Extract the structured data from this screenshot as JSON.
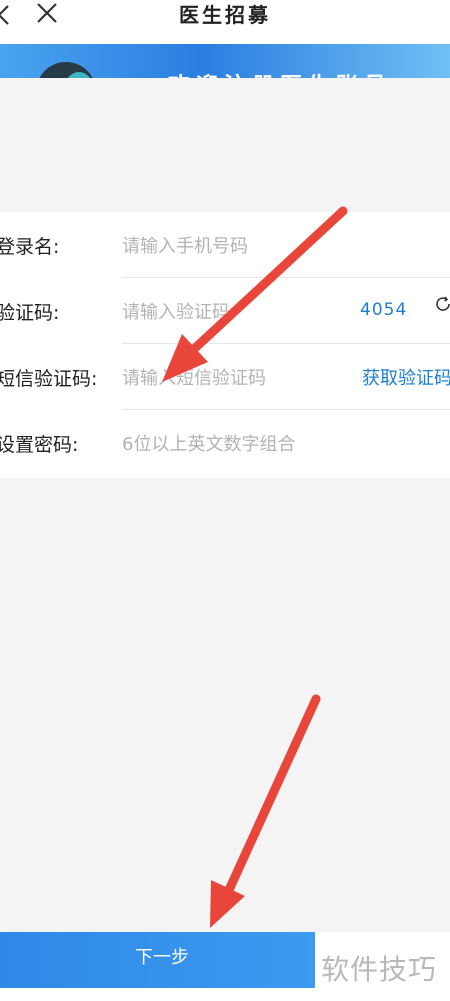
{
  "nav": {
    "back_glyph": "<",
    "close_glyph": "✕",
    "title": "医生招募"
  },
  "banner": {
    "text": "欢迎注册医生账号"
  },
  "form": {
    "rows": [
      {
        "label": "登录名:",
        "placeholder": "请输入手机号码"
      },
      {
        "label": "验证码:",
        "placeholder": "请输入验证码",
        "captcha": "4054"
      },
      {
        "label": "短信验证码:",
        "placeholder": "请输入短信验证码",
        "action": "获取验证码"
      },
      {
        "label": "设置密码:",
        "placeholder": "6位以上英文数字组合"
      }
    ]
  },
  "footer": {
    "next_label": "下一步"
  },
  "watermark": {
    "text": "软件技巧"
  },
  "colors": {
    "accent": "#1c7fd6",
    "arrow": "#e8463a",
    "button": "#3291ea"
  },
  "icons": {
    "back": "chevron-left-icon",
    "close": "close-icon",
    "refresh": "refresh-icon"
  }
}
